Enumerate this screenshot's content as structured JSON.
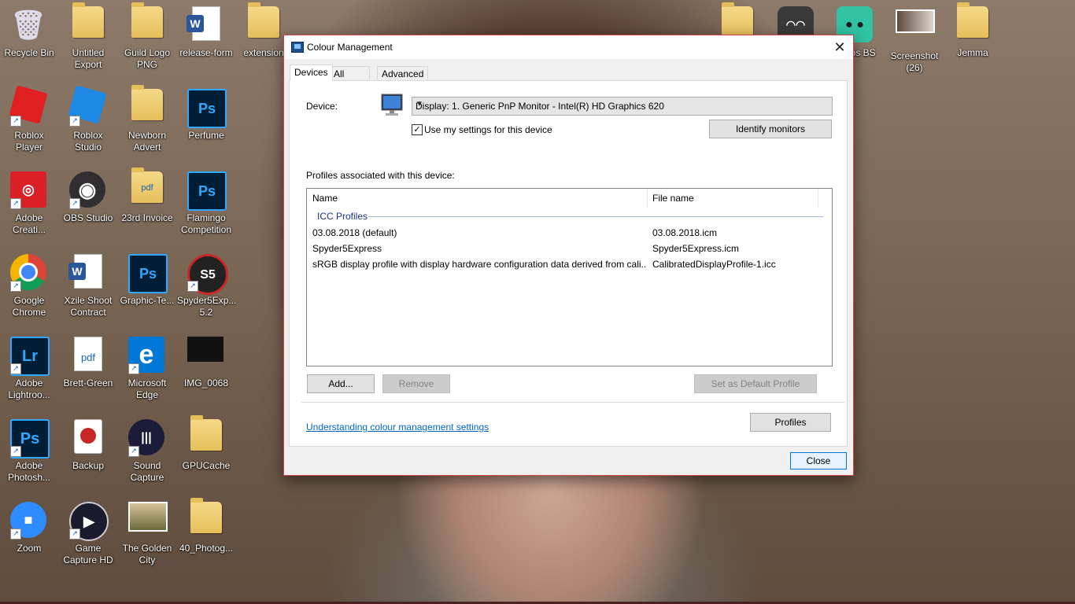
{
  "desktop": {
    "icons": [
      {
        "label": "Recycle Bin",
        "glyph": "🗑",
        "icon": "recycle-bin-icon"
      },
      {
        "label": "Untitled Export",
        "glyph": "",
        "icon": "folder-icon"
      },
      {
        "label": "Guild Logo PNG",
        "glyph": "",
        "icon": "folder-icon"
      },
      {
        "label": "release-form",
        "glyph": "W",
        "icon": "word-doc-icon"
      },
      {
        "label": "extension",
        "glyph": "",
        "icon": "folder-icon"
      },
      {
        "label": "Roblox Player",
        "glyph": "",
        "icon": "roblox-icon"
      },
      {
        "label": "Roblox Studio",
        "glyph": "",
        "icon": "roblox-studio-icon"
      },
      {
        "label": "Newborn Advert",
        "glyph": "",
        "icon": "folder-icon"
      },
      {
        "label": "Perfume",
        "glyph": "Ps",
        "icon": "psd-icon"
      },
      {
        "label": "Adobe Creati...",
        "glyph": "Cc",
        "icon": "adobe-cc-icon"
      },
      {
        "label": "OBS Studio",
        "glyph": "◉",
        "icon": "obs-icon"
      },
      {
        "label": "23rd Invoice",
        "glyph": "pdf",
        "icon": "pdf-icon"
      },
      {
        "label": "Flamingo Competition",
        "glyph": "Ps",
        "icon": "psd-icon"
      },
      {
        "label": "Google Chrome",
        "glyph": "",
        "icon": "chrome-icon"
      },
      {
        "label": "Xzile Shoot Contract",
        "glyph": "W",
        "icon": "word-doc-icon"
      },
      {
        "label": "Graphic-Te...",
        "glyph": "Ps",
        "icon": "psd-icon"
      },
      {
        "label": "Spyder5Exp... 5.2",
        "glyph": "S5",
        "icon": "spyder-icon"
      },
      {
        "label": "Adobe Lightroo...",
        "glyph": "Lr",
        "icon": "lightroom-icon"
      },
      {
        "label": "Brett-Green",
        "glyph": "pdf",
        "icon": "pdf-icon"
      },
      {
        "label": "Microsoft Edge",
        "glyph": "e",
        "icon": "edge-icon"
      },
      {
        "label": "IMG_0068",
        "glyph": "",
        "icon": "image-icon"
      },
      {
        "label": "Adobe Photosh...",
        "glyph": "Ps",
        "icon": "photoshop-icon"
      },
      {
        "label": "Backup",
        "glyph": "",
        "icon": "backup-icon"
      },
      {
        "label": "Sound Capture",
        "glyph": "",
        "icon": "sound-capture-icon"
      },
      {
        "label": "GPUCache",
        "glyph": "",
        "icon": "folder-icon"
      },
      {
        "label": "Zoom",
        "glyph": "",
        "icon": "zoom-icon"
      },
      {
        "label": "Game Capture HD",
        "glyph": "▶",
        "icon": "game-capture-icon"
      },
      {
        "label": "The Golden City",
        "glyph": "",
        "icon": "image-icon"
      },
      {
        "label": "40_Photog...",
        "glyph": "",
        "icon": "folder-icon"
      },
      {
        "label": "",
        "glyph": "",
        "icon": "folder-icon"
      },
      {
        "label": "",
        "glyph": "",
        "icon": "cat-app-icon"
      },
      {
        "label": "mlabs BS",
        "glyph": "",
        "icon": "streamlabs-icon"
      },
      {
        "label": "Screenshot (26)",
        "glyph": "",
        "icon": "image-icon"
      },
      {
        "label": "Jemma",
        "glyph": "",
        "icon": "folder-icon"
      }
    ]
  },
  "dialog": {
    "title": "Colour Management",
    "close_glyph": "✕",
    "tabs": [
      "Devices",
      "All Profiles",
      "Advanced"
    ],
    "device_label": "Device:",
    "device_value": "Display: 1. Generic PnP Monitor - Intel(R) HD Graphics 620",
    "use_settings_label": "Use my settings for this device",
    "use_settings_checked": "✓",
    "identify_button": "Identify monitors",
    "profiles_label": "Profiles associated with this device:",
    "columns": [
      "Name",
      "File name"
    ],
    "group_label": "ICC Profiles",
    "rows": [
      {
        "name": "03.08.2018 (default)",
        "file": "03.08.2018.icm"
      },
      {
        "name": "Spyder5Express",
        "file": "Spyder5Express.icm"
      },
      {
        "name": "sRGB display profile with display hardware configuration data derived from cali...",
        "file": "CalibratedDisplayProfile-1.icc"
      }
    ],
    "add_button": "Add...",
    "remove_button": "Remove",
    "set_default_button": "Set as Default Profile",
    "link_text": "Understanding colour management settings",
    "profiles_button": "Profiles",
    "close_button": "Close"
  }
}
